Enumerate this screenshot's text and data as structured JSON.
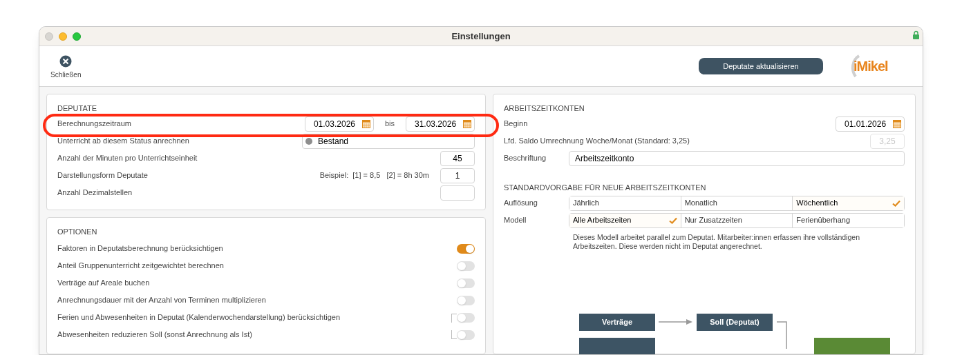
{
  "window": {
    "title": "Einstellungen"
  },
  "toolbar": {
    "close_label": "Schließen",
    "update_button": "Deputate aktualisieren",
    "logo": "iMikel"
  },
  "deputate": {
    "heading": "DEPUTATE",
    "rows": [
      {
        "kind": "date_range",
        "label": "Berechnungszeitraum",
        "from": "01.03.2026",
        "separator": "bis",
        "to": "31.03.2026"
      },
      {
        "kind": "status",
        "label": "Unterricht ab diesem Status anrechnen",
        "value": "Bestand",
        "color": "#8e8e8e"
      },
      {
        "kind": "number",
        "label": "Anzahl der Minuten pro Unterrichtseinheit",
        "value": "45"
      },
      {
        "kind": "number",
        "label": "Darstellungsform Deputate",
        "hint": "Beispiel:  [1] = 8,5   [2] = 8h 30m",
        "value": "1"
      },
      {
        "kind": "number",
        "label": "Anzahl Dezimalstellen"
      }
    ]
  },
  "options": {
    "heading": "OPTIONEN",
    "items": [
      {
        "label": "Faktoren in Deputatsberechnung berücksichtigen",
        "on": true,
        "linked": false
      },
      {
        "label": "Anteil Gruppenunterricht zeitgewichtet berechnen",
        "on": false,
        "linked": false
      },
      {
        "label": "Verträge auf Areale buchen",
        "on": false,
        "linked": false
      },
      {
        "label": "Anrechnungsdauer mit der Anzahl von Terminen multiplizieren",
        "on": false,
        "linked": false
      },
      {
        "label": "Ferien und Abwesenheiten in Deputat (Kalenderwochendarstellung) berücksichtigen",
        "on": false,
        "linked": true
      },
      {
        "label": "Abwesenheiten reduzieren Soll (sonst Anrechnung als Ist)",
        "on": false,
        "linked": true
      }
    ]
  },
  "konten": {
    "heading": "ARBEITSZEITKONTEN",
    "rows": [
      {
        "kind": "date",
        "label": "Beginn",
        "value": "01.01.2026"
      },
      {
        "kind": "number",
        "label": "Lfd. Saldo Umrechnung Woche/Monat (Standard: 3,25)",
        "placeholder": "3,25",
        "disabled": true
      },
      {
        "kind": "text",
        "label": "Beschriftung",
        "value": "Arbeitszeitkonto"
      }
    ]
  },
  "standard": {
    "heading": "STANDARDVORGABE FÜR NEUE ARBEITSZEITKONTEN",
    "groups": [
      {
        "label": "Auflösung",
        "options": [
          {
            "label": "Jährlich",
            "selected": false
          },
          {
            "label": "Monatlich",
            "selected": false
          },
          {
            "label": "Wöchentlich",
            "selected": true
          }
        ]
      },
      {
        "label": "Modell",
        "options": [
          {
            "label": "Alle Arbeitszeiten",
            "selected": true
          },
          {
            "label": "Nur Zusatzzeiten",
            "selected": false
          },
          {
            "label": "Ferienüberhang",
            "selected": false
          }
        ]
      }
    ],
    "description": "Dieses Modell arbeitet parallel zum Deputat. Mitarbeiter:innen erfassen ihre vollständigen Arbeitszeiten. Diese werden nicht im Deputat angerechnet."
  },
  "diagram": {
    "nodes": [
      {
        "label": "Verträge",
        "kind": "dark"
      },
      {
        "label": "Soll (Deputat)",
        "kind": "dark"
      },
      {
        "kind": "dark"
      },
      {
        "kind": "green"
      }
    ]
  }
}
